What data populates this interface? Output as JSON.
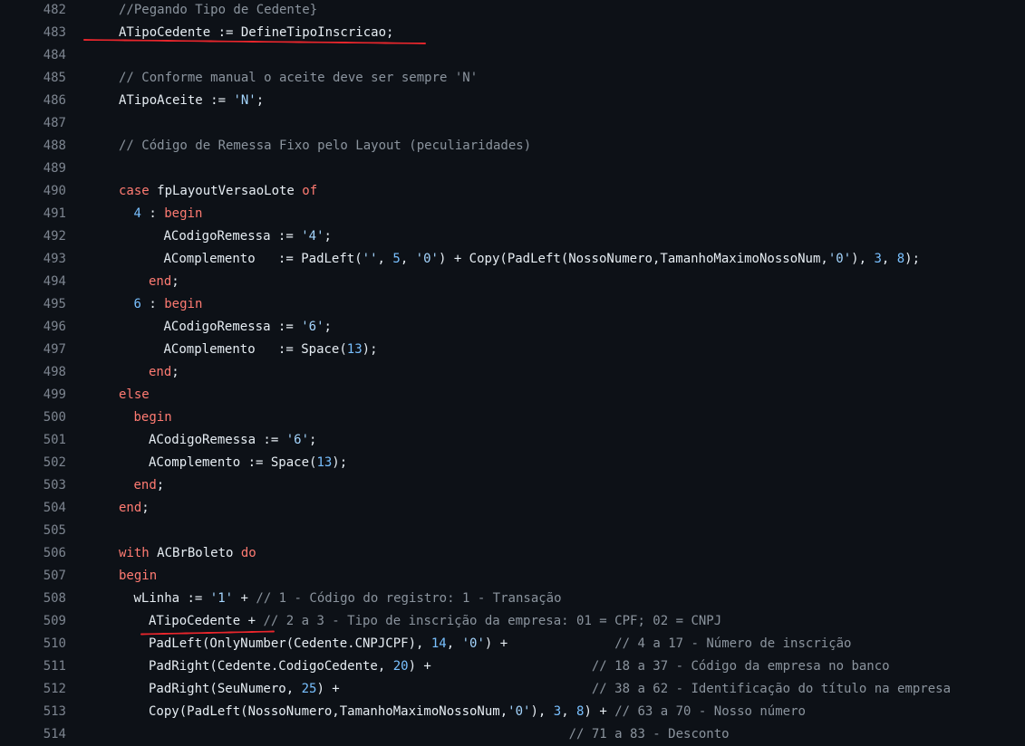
{
  "editor": {
    "theme_colors": {
      "background": "#0d1117",
      "line_number": "#7d8590",
      "comment": "#8b949e",
      "keyword": "#ff7b72",
      "string": "#a5d6ff",
      "number": "#79c0ff",
      "text": "#e6edf3",
      "annotation": "#e8262c"
    },
    "annotations": [
      {
        "type": "red-underline",
        "line": "483"
      },
      {
        "type": "red-underline",
        "line": "509"
      }
    ],
    "lines": [
      {
        "num": "482",
        "indent": 0,
        "tokens": [
          {
            "t": "c",
            "v": "//Pegando Tipo de Cedente}"
          }
        ]
      },
      {
        "num": "483",
        "indent": 0,
        "tokens": [
          {
            "t": "t",
            "v": "ATipoCedente := DefineTipoInscricao;"
          }
        ]
      },
      {
        "num": "484",
        "indent": 0,
        "tokens": []
      },
      {
        "num": "485",
        "indent": 0,
        "tokens": [
          {
            "t": "c",
            "v": "// Conforme manual o aceite deve ser sempre 'N'"
          }
        ]
      },
      {
        "num": "486",
        "indent": 0,
        "tokens": [
          {
            "t": "t",
            "v": "ATipoAceite := "
          },
          {
            "t": "s",
            "v": "'N'"
          },
          {
            "t": "t",
            "v": ";"
          }
        ]
      },
      {
        "num": "487",
        "indent": 0,
        "tokens": []
      },
      {
        "num": "488",
        "indent": 0,
        "tokens": [
          {
            "t": "c",
            "v": "// Código de Remessa Fixo pelo Layout (peculiaridades)"
          }
        ]
      },
      {
        "num": "489",
        "indent": 0,
        "tokens": []
      },
      {
        "num": "490",
        "indent": 0,
        "tokens": [
          {
            "t": "k",
            "v": "case"
          },
          {
            "t": "t",
            "v": " fpLayoutVersaoLote "
          },
          {
            "t": "k",
            "v": "of"
          }
        ]
      },
      {
        "num": "491",
        "indent": 2,
        "tokens": [
          {
            "t": "n",
            "v": "4"
          },
          {
            "t": "t",
            "v": " : "
          },
          {
            "t": "k",
            "v": "begin"
          }
        ]
      },
      {
        "num": "492",
        "indent": 6,
        "tokens": [
          {
            "t": "t",
            "v": "ACodigoRemessa := "
          },
          {
            "t": "s",
            "v": "'4'"
          },
          {
            "t": "t",
            "v": ";"
          }
        ]
      },
      {
        "num": "493",
        "indent": 6,
        "tokens": [
          {
            "t": "t",
            "v": "AComplemento   := PadLeft("
          },
          {
            "t": "s",
            "v": "''"
          },
          {
            "t": "t",
            "v": ", "
          },
          {
            "t": "n",
            "v": "5"
          },
          {
            "t": "t",
            "v": ", "
          },
          {
            "t": "s",
            "v": "'0'"
          },
          {
            "t": "t",
            "v": ") + Copy(PadLeft(NossoNumero,TamanhoMaximoNossoNum,"
          },
          {
            "t": "s",
            "v": "'0'"
          },
          {
            "t": "t",
            "v": "), "
          },
          {
            "t": "n",
            "v": "3"
          },
          {
            "t": "t",
            "v": ", "
          },
          {
            "t": "n",
            "v": "8"
          },
          {
            "t": "t",
            "v": ");"
          }
        ]
      },
      {
        "num": "494",
        "indent": 4,
        "tokens": [
          {
            "t": "k",
            "v": "end"
          },
          {
            "t": "t",
            "v": ";"
          }
        ]
      },
      {
        "num": "495",
        "indent": 2,
        "tokens": [
          {
            "t": "n",
            "v": "6"
          },
          {
            "t": "t",
            "v": " : "
          },
          {
            "t": "k",
            "v": "begin"
          }
        ]
      },
      {
        "num": "496",
        "indent": 6,
        "tokens": [
          {
            "t": "t",
            "v": "ACodigoRemessa := "
          },
          {
            "t": "s",
            "v": "'6'"
          },
          {
            "t": "t",
            "v": ";"
          }
        ]
      },
      {
        "num": "497",
        "indent": 6,
        "tokens": [
          {
            "t": "t",
            "v": "AComplemento   := Space("
          },
          {
            "t": "n",
            "v": "13"
          },
          {
            "t": "t",
            "v": ");"
          }
        ]
      },
      {
        "num": "498",
        "indent": 4,
        "tokens": [
          {
            "t": "k",
            "v": "end"
          },
          {
            "t": "t",
            "v": ";"
          }
        ]
      },
      {
        "num": "499",
        "indent": 0,
        "tokens": [
          {
            "t": "k",
            "v": "else"
          }
        ]
      },
      {
        "num": "500",
        "indent": 2,
        "tokens": [
          {
            "t": "k",
            "v": "begin"
          }
        ]
      },
      {
        "num": "501",
        "indent": 4,
        "tokens": [
          {
            "t": "t",
            "v": "ACodigoRemessa := "
          },
          {
            "t": "s",
            "v": "'6'"
          },
          {
            "t": "t",
            "v": ";"
          }
        ]
      },
      {
        "num": "502",
        "indent": 4,
        "tokens": [
          {
            "t": "t",
            "v": "AComplemento := Space("
          },
          {
            "t": "n",
            "v": "13"
          },
          {
            "t": "t",
            "v": ");"
          }
        ]
      },
      {
        "num": "503",
        "indent": 2,
        "tokens": [
          {
            "t": "k",
            "v": "end"
          },
          {
            "t": "t",
            "v": ";"
          }
        ]
      },
      {
        "num": "504",
        "indent": 0,
        "tokens": [
          {
            "t": "k",
            "v": "end"
          },
          {
            "t": "t",
            "v": ";"
          }
        ]
      },
      {
        "num": "505",
        "indent": 0,
        "tokens": []
      },
      {
        "num": "506",
        "indent": 0,
        "tokens": [
          {
            "t": "k",
            "v": "with"
          },
          {
            "t": "t",
            "v": " ACBrBoleto "
          },
          {
            "t": "k",
            "v": "do"
          }
        ]
      },
      {
        "num": "507",
        "indent": 0,
        "tokens": [
          {
            "t": "k",
            "v": "begin"
          }
        ]
      },
      {
        "num": "508",
        "indent": 2,
        "tokens": [
          {
            "t": "t",
            "v": "wLinha := "
          },
          {
            "t": "s",
            "v": "'1'"
          },
          {
            "t": "t",
            "v": " + "
          },
          {
            "t": "c",
            "v": "// 1 - Código do registro: 1 - Transação"
          }
        ]
      },
      {
        "num": "509",
        "indent": 4,
        "tokens": [
          {
            "t": "t",
            "v": "ATipoCedente + "
          },
          {
            "t": "c",
            "v": "// 2 a 3 - Tipo de inscrição da empresa: 01 = CPF; 02 = CNPJ"
          }
        ]
      },
      {
        "num": "510",
        "indent": 4,
        "tokens": [
          {
            "t": "t",
            "v": "PadLeft(OnlyNumber(Cedente.CNPJCPF), "
          },
          {
            "t": "n",
            "v": "14"
          },
          {
            "t": "t",
            "v": ", "
          },
          {
            "t": "s",
            "v": "'0'"
          },
          {
            "t": "t",
            "v": ") +              "
          },
          {
            "t": "c",
            "v": "// 4 a 17 - Número de inscrição"
          }
        ]
      },
      {
        "num": "511",
        "indent": 4,
        "tokens": [
          {
            "t": "t",
            "v": "PadRight(Cedente.CodigoCedente, "
          },
          {
            "t": "n",
            "v": "20"
          },
          {
            "t": "t",
            "v": ") +                     "
          },
          {
            "t": "c",
            "v": "// 18 a 37 - Código da empresa no banco"
          }
        ]
      },
      {
        "num": "512",
        "indent": 4,
        "tokens": [
          {
            "t": "t",
            "v": "PadRight(SeuNumero, "
          },
          {
            "t": "n",
            "v": "25"
          },
          {
            "t": "t",
            "v": ") +                                 "
          },
          {
            "t": "c",
            "v": "// 38 a 62 - Identificação do título na empresa"
          }
        ]
      },
      {
        "num": "513",
        "indent": 4,
        "tokens": [
          {
            "t": "t",
            "v": "Copy(PadLeft(NossoNumero,TamanhoMaximoNossoNum,"
          },
          {
            "t": "s",
            "v": "'0'"
          },
          {
            "t": "t",
            "v": "), "
          },
          {
            "t": "n",
            "v": "3"
          },
          {
            "t": "t",
            "v": ", "
          },
          {
            "t": "n",
            "v": "8"
          },
          {
            "t": "t",
            "v": ") + "
          },
          {
            "t": "c",
            "v": "// 63 a 70 - Nosso número"
          }
        ]
      },
      {
        "num": "514",
        "indent": 4,
        "tokens": [
          {
            "t": "t",
            "v": "       "
          },
          {
            "t": "c",
            "v": "                                                // 71 a 83 - Desconto"
          }
        ]
      }
    ]
  }
}
